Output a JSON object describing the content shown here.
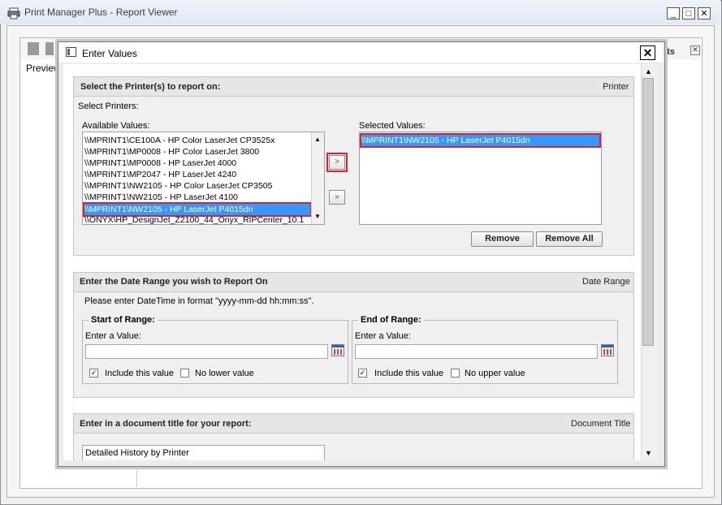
{
  "window": {
    "title": "Print Manager Plus - Report Viewer",
    "minimize_label": "_",
    "maximize_label": "□",
    "close_label": "✕"
  },
  "viewer": {
    "tab_preview": "Preview",
    "partial_toolbar_text": "cts",
    "partial_close": "✕"
  },
  "dialog": {
    "title": "Enter Values",
    "close_label": "✕",
    "printers": {
      "header": "Select the Printer(s) to report on:",
      "header_right": "Printer",
      "subtitle": "Select Printers:",
      "available_label": "Available Values:",
      "selected_label": "Selected Values:",
      "available": [
        "\\\\MPRINT1\\CE100A - HP Color LaserJet CP3525x",
        "\\\\MPRINT1\\MP0008 - HP Color LaserJet 3800",
        "\\\\MPRINT1\\MP0008 - HP LaserJet 4000",
        "\\\\MPRINT1\\MP2047 - HP LaserJet 4240",
        "\\\\MPRINT1\\NW2105 - HP Color LaserJet CP3505",
        "\\\\MPRINT1\\NW2105 - HP LaserJet 4100",
        "\\\\MPRINT1\\NW2105 - HP LaserJet P4015dn",
        "\\\\ONYX\\HP_DesignJet_Z2100_44_Onyx_RIPCenter_10.1"
      ],
      "selected": [
        "\\\\MPRINT1\\NW2105 - HP LaserJet P4015dn"
      ],
      "add_label": ">",
      "add_all_label": "»",
      "remove_label": "Remove",
      "remove_all_label": "Remove All"
    },
    "date_range": {
      "header": "Enter the Date Range you wish to Report On",
      "header_right": "Date Range",
      "hint": "Please enter DateTime in format \"yyyy-mm-dd hh:mm:ss\".",
      "start": {
        "legend": "Start of Range:",
        "enter_label": "Enter a Value:",
        "value": "",
        "include_label": "Include this value",
        "include_checked": "✓",
        "none_label": "No lower value"
      },
      "end": {
        "legend": "End of Range:",
        "enter_label": "Enter a Value:",
        "value": "",
        "include_label": "Include this value",
        "include_checked": "✓",
        "none_label": "No upper value"
      }
    },
    "doc_title": {
      "header": "Enter in a document title for your report:",
      "header_right": "Document Title",
      "value": "Detailed History by Printer"
    }
  }
}
